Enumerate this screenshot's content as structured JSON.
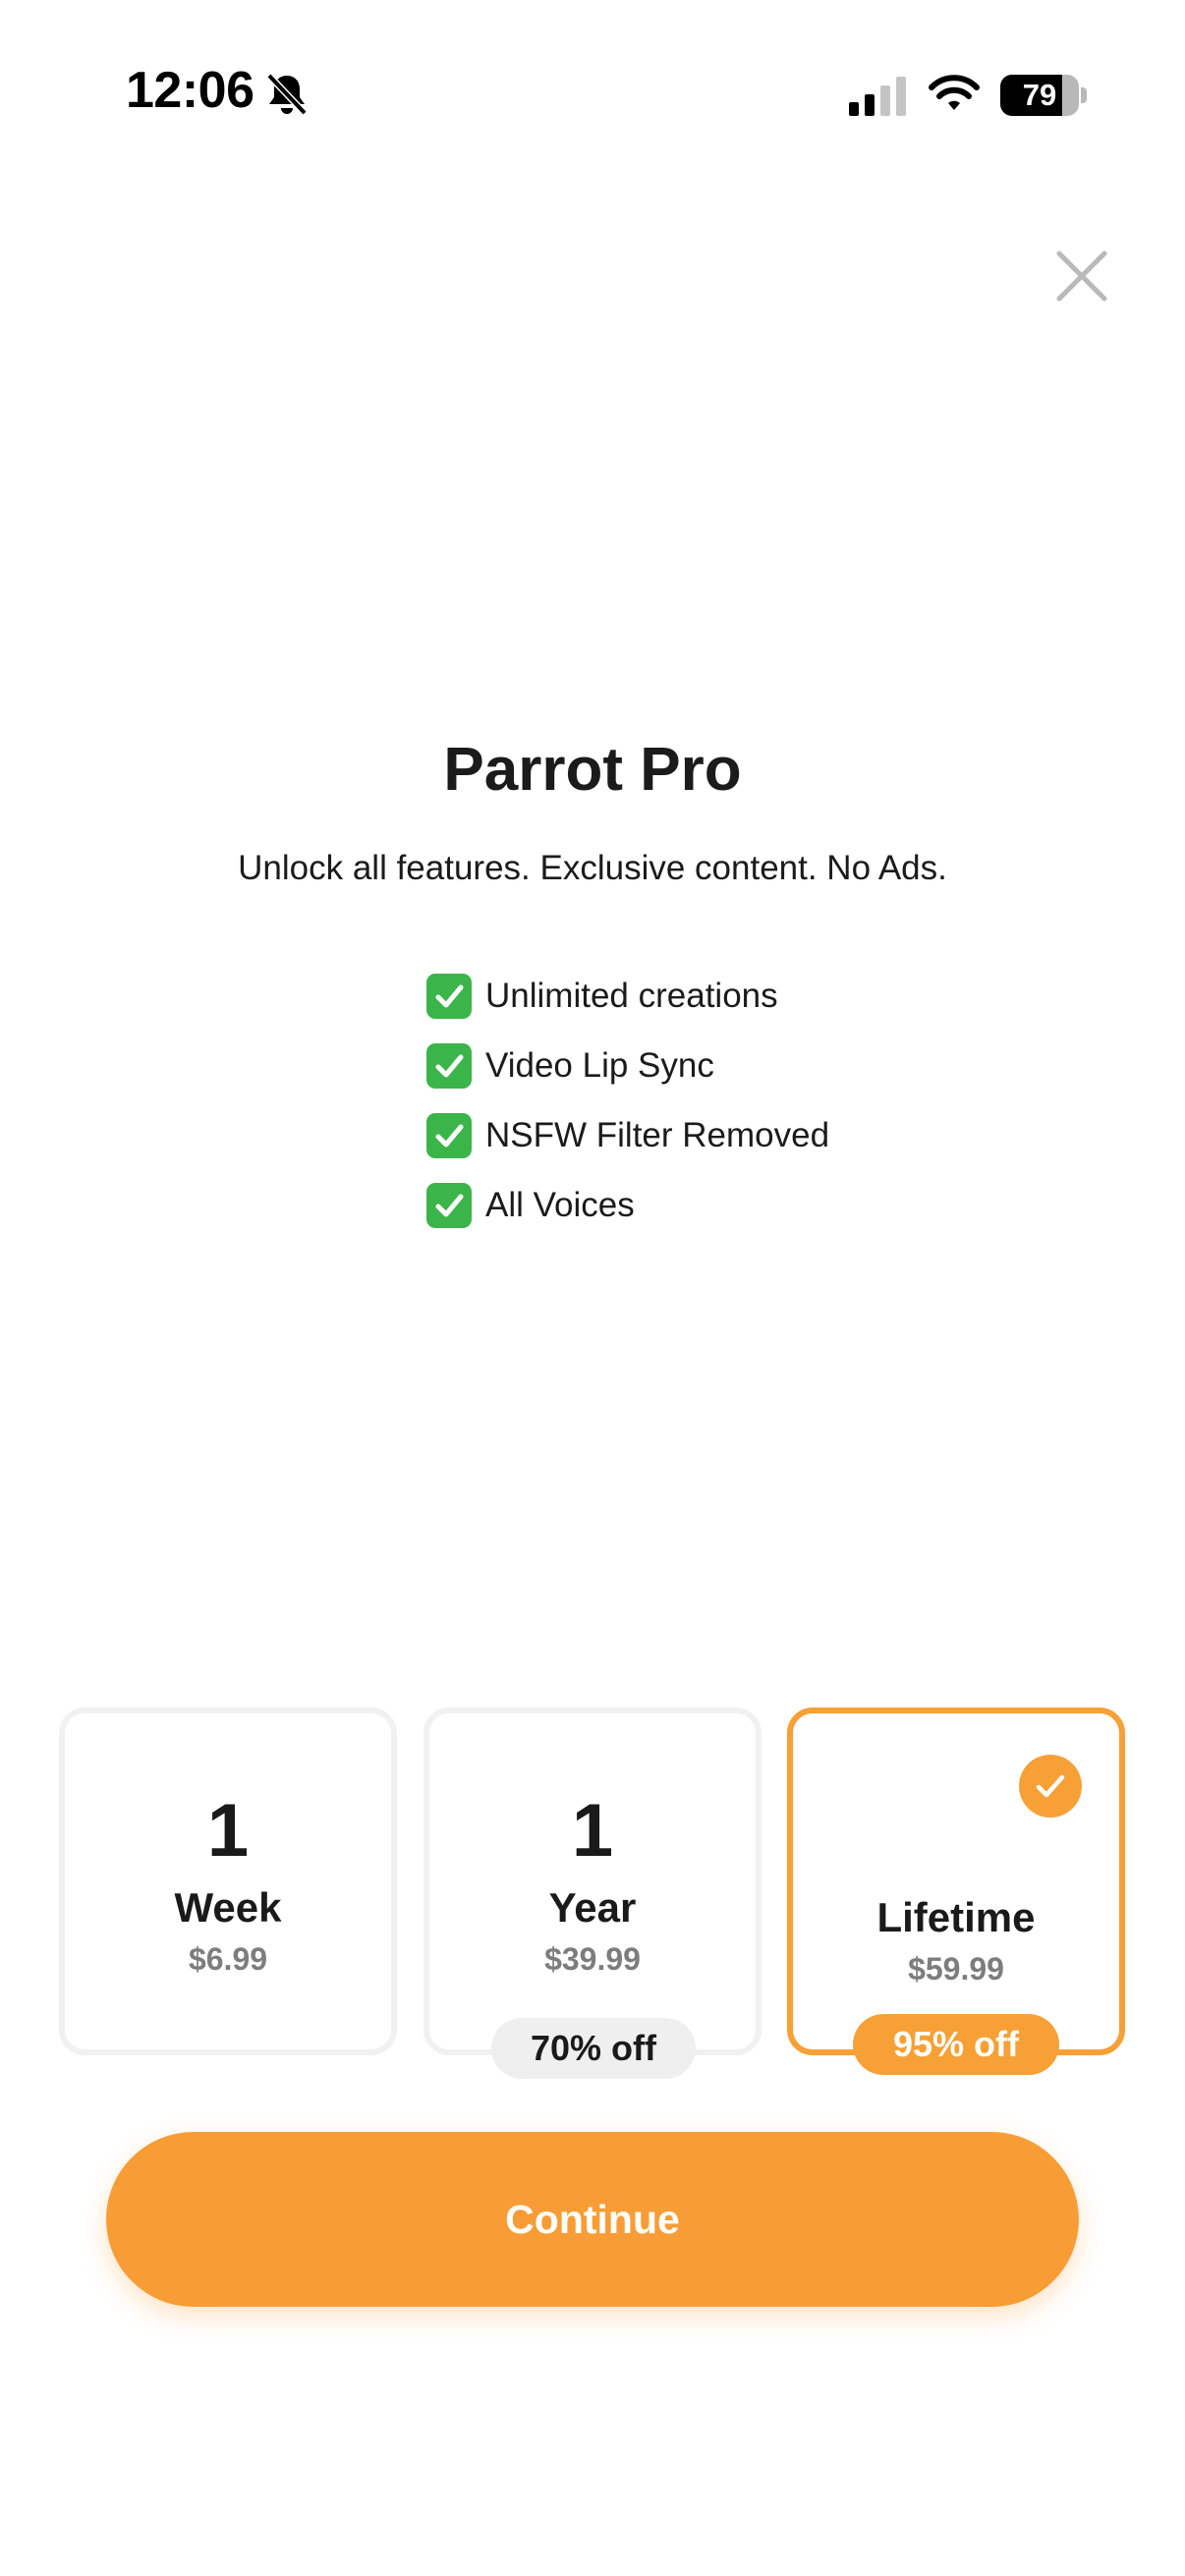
{
  "status_bar": {
    "time": "12:06",
    "battery_percent": "79",
    "battery_level": 0.79
  },
  "paywall": {
    "title": "Parrot Pro",
    "subtitle": "Unlock all features. Exclusive content. No Ads.",
    "features": [
      {
        "icon": "check-box-icon",
        "label": "Unlimited creations"
      },
      {
        "icon": "check-box-icon",
        "label": "Video Lip Sync"
      },
      {
        "icon": "check-box-icon",
        "label": "NSFW Filter Removed"
      },
      {
        "icon": "check-box-icon",
        "label": "All Voices"
      }
    ]
  },
  "plans": [
    {
      "number": "1",
      "name": "Week",
      "price": "$6.99",
      "badge": "",
      "selected": false
    },
    {
      "number": "1",
      "name": "Year",
      "price": "$39.99",
      "badge": "70% off",
      "selected": false
    },
    {
      "number": "",
      "name": "Lifetime",
      "price": "$59.99",
      "badge": "95% off",
      "selected": true
    }
  ],
  "continue_label": "Continue",
  "colors": {
    "accent": "#f89d35",
    "check_green": "#3bb54a",
    "unselected_border": "#f1f1f1",
    "muted_text": "#7d7d7d"
  }
}
